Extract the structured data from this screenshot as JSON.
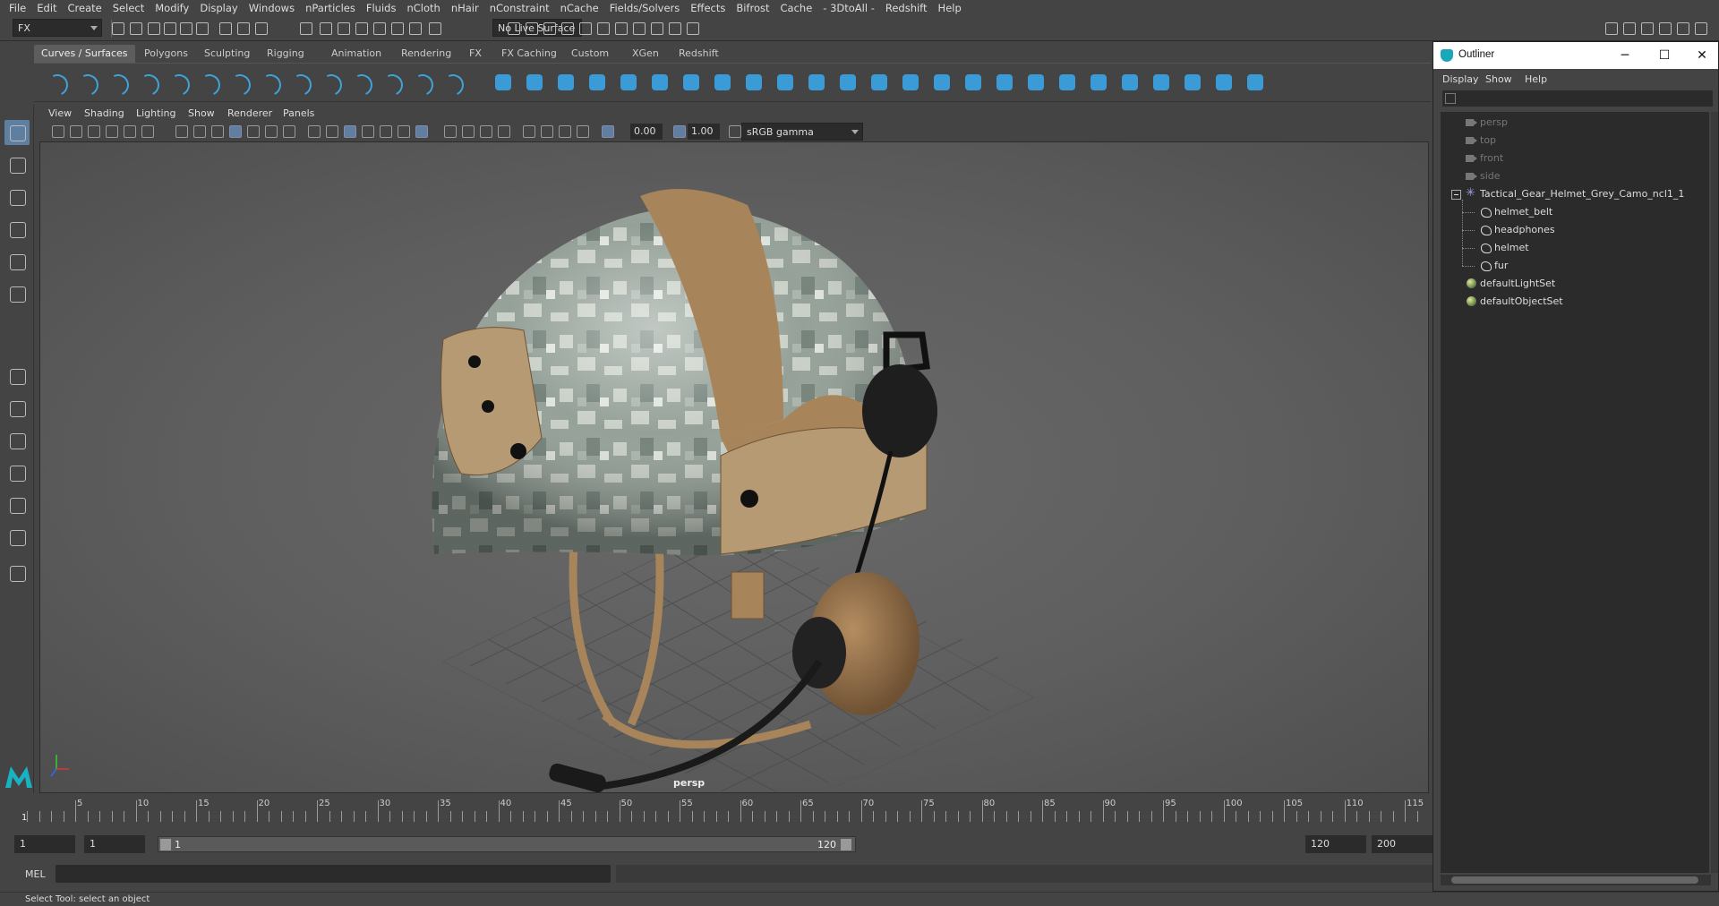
{
  "menubar": {
    "items": [
      "File",
      "Edit",
      "Create",
      "Select",
      "Modify",
      "Display",
      "Windows",
      "nParticles",
      "Fluids",
      "nCloth",
      "nHair",
      "nConstraint",
      "nCache",
      "Fields/Solvers",
      "Effects",
      "Bifrost",
      "Cache",
      "- 3DtoAll -",
      "Redshift",
      "Help"
    ]
  },
  "statusline": {
    "mode": "FX",
    "live_surface": "No Live Surface"
  },
  "shelf": {
    "tabs": [
      "Curves / Surfaces",
      "Polygons",
      "Sculpting",
      "Rigging",
      "Animation",
      "Rendering",
      "FX",
      "FX Caching",
      "Custom",
      "XGen",
      "Redshift"
    ],
    "active_tab": "Curves / Surfaces"
  },
  "panel": {
    "menus": [
      "View",
      "Shading",
      "Lighting",
      "Show",
      "Renderer",
      "Panels"
    ],
    "exposure": "0.00",
    "gamma": "1.00",
    "color_space": "sRGB gamma",
    "camera_label": "persp"
  },
  "timeline": {
    "ticks": [
      5,
      10,
      15,
      20,
      25,
      30,
      35,
      40,
      45,
      50,
      55,
      60,
      65,
      70,
      75,
      80,
      85,
      90,
      95,
      100,
      105,
      110,
      115
    ],
    "current_frame": "1"
  },
  "range": {
    "start": "1",
    "playback_start": "1",
    "slider_start": "1",
    "slider_end": "120",
    "playback_end": "120",
    "end": "200"
  },
  "cmdline": {
    "label": "MEL"
  },
  "helpline": {
    "text": "Select Tool: select an object"
  },
  "outliner": {
    "title": "Outliner",
    "menus": [
      "Display",
      "Show",
      "Help"
    ],
    "cameras": [
      "persp",
      "top",
      "front",
      "side"
    ],
    "group": "Tactical_Gear_Helmet_Grey_Camo_ncl1_1",
    "children": [
      "helmet_belt",
      "headphones",
      "helmet",
      "fur"
    ],
    "sets": [
      "defaultLightSet",
      "defaultObjectSet"
    ]
  },
  "colors": {
    "accent": "#3ea3d9",
    "viewport_bg": "#5f5f5f",
    "camo_light": "#c7cec4",
    "camo_mid": "#8f9c93",
    "tan": "#a8845a"
  },
  "icons": {
    "window_minimize": "─",
    "window_maximize": "☐",
    "window_close": "✕"
  }
}
